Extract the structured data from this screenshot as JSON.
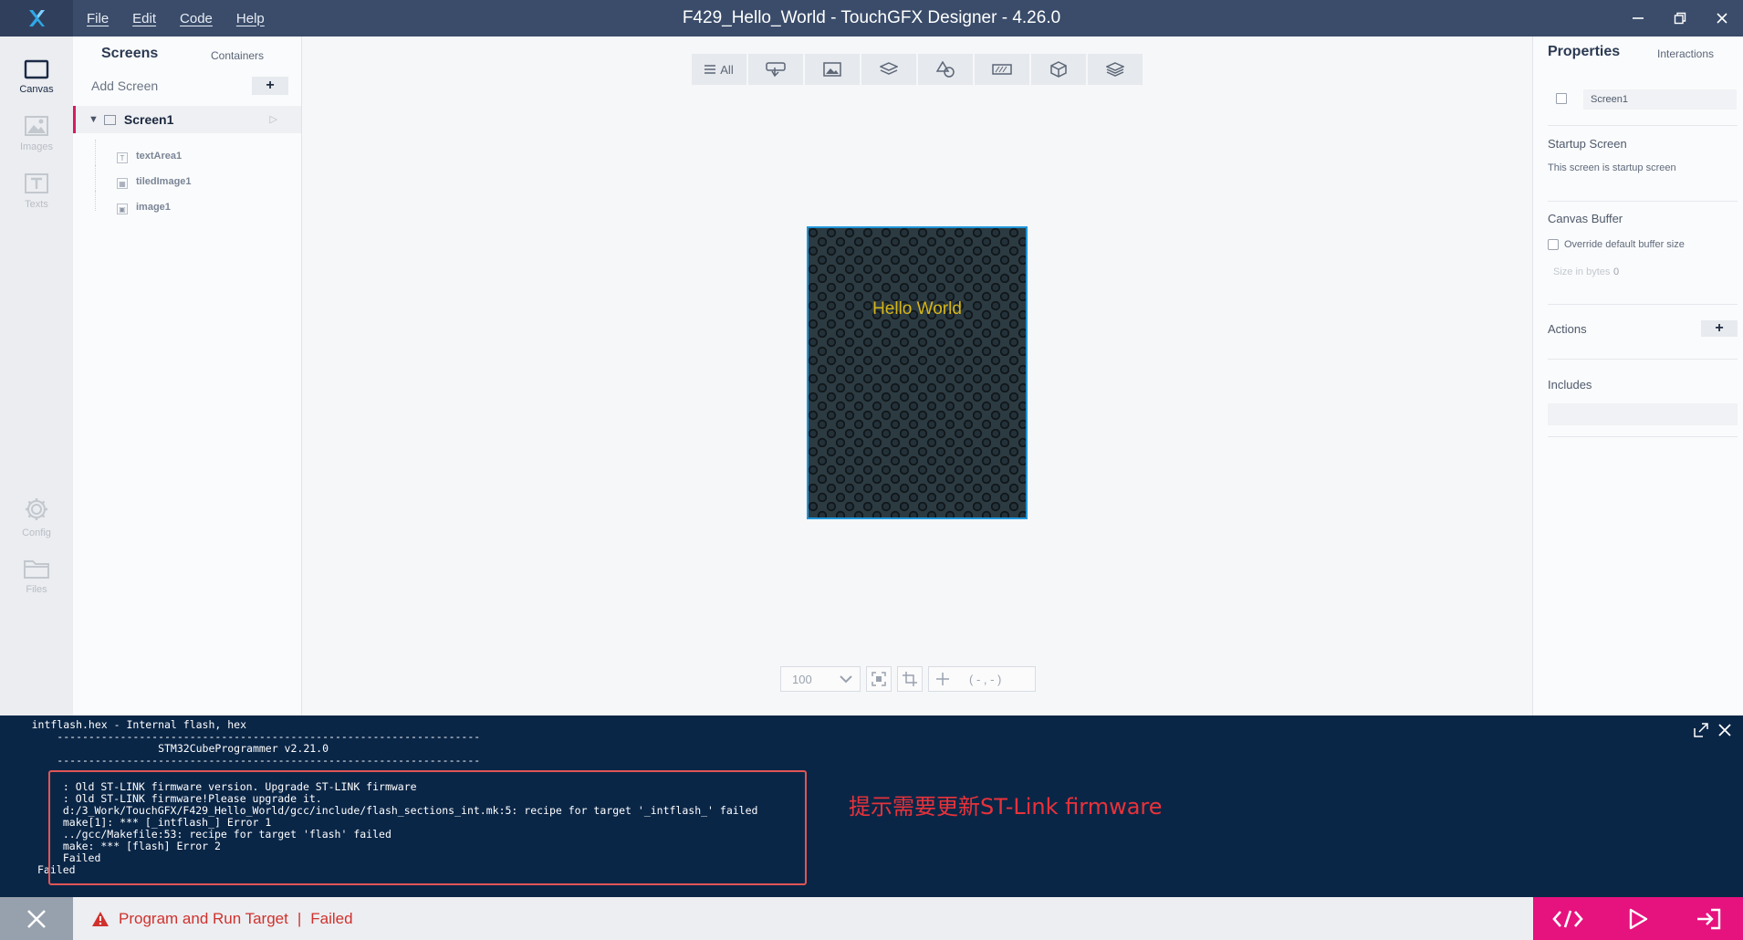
{
  "window": {
    "title": "F429_Hello_World - TouchGFX Designer - 4.26.0",
    "menu": [
      "File",
      "Edit",
      "Code",
      "Help"
    ]
  },
  "leftnav": {
    "canvas": "Canvas",
    "images": "Images",
    "texts": "Texts",
    "config": "Config",
    "files": "Files"
  },
  "screens_panel": {
    "tab_screens": "Screens",
    "tab_containers": "Containers",
    "add_screen": "Add Screen",
    "add_symbol": "+",
    "screen_name": "Screen1",
    "widgets": [
      {
        "label": "textArea1",
        "icon": "text-icon"
      },
      {
        "label": "tiledImage1",
        "icon": "tiled-image-icon"
      },
      {
        "label": "image1",
        "icon": "image-icon"
      }
    ]
  },
  "canvas": {
    "filter_all": "All",
    "hello_text": "Hello World",
    "hello_color": "#d6b51b",
    "zoom_level": "100",
    "coordinates": "( - , - )"
  },
  "properties": {
    "tab_properties": "Properties",
    "tab_interactions": "Interactions",
    "screen_name": "Screen1",
    "startup_title": "Startup Screen",
    "startup_desc": "This screen is startup screen",
    "canvas_buffer_title": "Canvas Buffer",
    "override_label": "Override default buffer size",
    "size_label": "Size in bytes",
    "size_value": "0",
    "actions_title": "Actions",
    "add_symbol": "+",
    "includes_title": "Includes"
  },
  "console": {
    "lines_top": [
      "     intflash.hex - Internal flash, hex",
      "         -------------------------------------------------------------------",
      "                         STM32CubeProgrammer v2.21.0",
      "         -------------------------------------------------------------------"
    ],
    "lines_error": [
      "  : Old ST-LINK firmware version. Upgrade ST-LINK firmware",
      "  : Old ST-LINK firmware!Please upgrade it.",
      "  d:/3_Work/TouchGFX/F429_Hello_World/gcc/include/flash_sections_int.mk:5: recipe for target '_intflash_' failed",
      "  make[1]: *** [_intflash_] Error 1",
      "  ../gcc/Makefile:53: recipe for target 'flash' failed",
      "  make: *** [flash] Error 2",
      "  Failed",
      "Failed"
    ],
    "annotation": "提示需要更新ST-Link firmware",
    "annotation_color": "#e8323a"
  },
  "status": {
    "message": "Program and Run Target",
    "separator": "|",
    "result": "Failed",
    "error_color": "#d0312d",
    "accent": "#e6127e"
  }
}
